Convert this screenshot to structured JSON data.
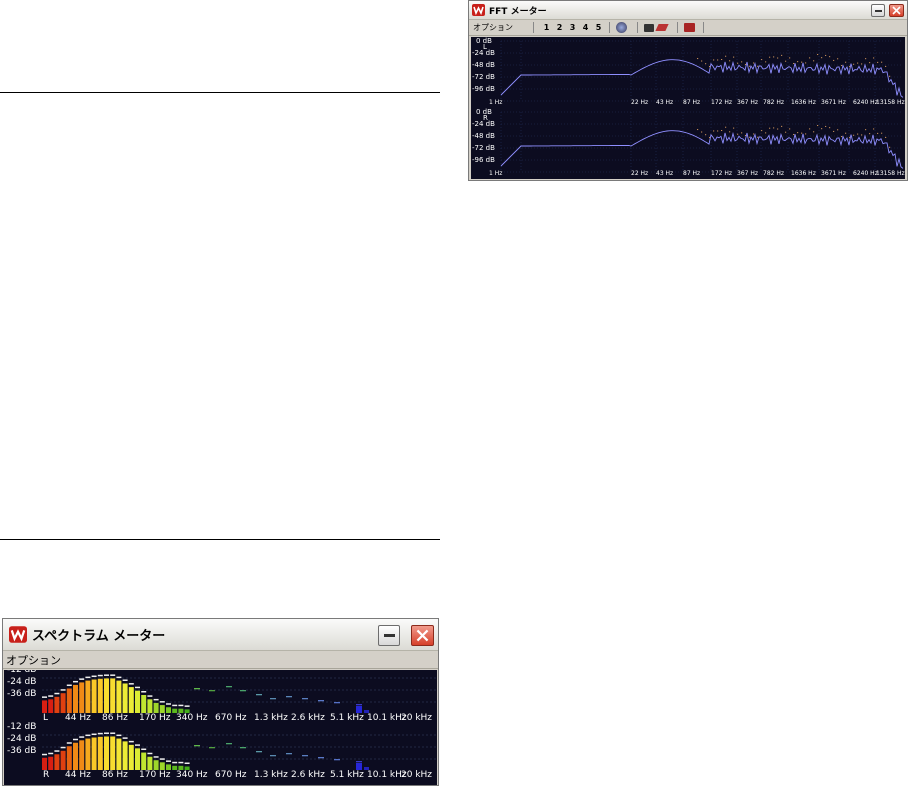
{
  "spectrum_window": {
    "title": "スペクトラム メーター",
    "menu_label": "オプション",
    "db_labels": [
      "-12 dB",
      "-24 dB",
      "-36 dB"
    ],
    "channels": [
      "L",
      "R"
    ],
    "freq_labels": [
      "44 Hz",
      "86 Hz",
      "170 Hz",
      "340 Hz",
      "670 Hz",
      "1.3 kHz",
      "2.6 kHz",
      "5.1 kHz",
      "10.1 kHz",
      "20 kHz"
    ]
  },
  "fft_window": {
    "title": "FFT メーター",
    "menu_label": "オプション",
    "preset_buttons": [
      "1",
      "2",
      "3",
      "4",
      "5"
    ],
    "db_labels": [
      "0 dB",
      "-24 dB",
      "-48 dB",
      "-72 dB",
      "-96 dB"
    ],
    "channels": [
      "L",
      "R"
    ],
    "freq_labels": [
      "1 Hz",
      "22 Hz",
      "43 Hz",
      "87 Hz",
      "172 Hz",
      "367 Hz",
      "782 Hz",
      "1636 Hz",
      "3671 Hz",
      "6240 Hz",
      "13158 Hz"
    ]
  },
  "colors": {
    "screen_bg": "#0c0c20",
    "fft_curve": "#8f8fff",
    "fft_peak": "#c8905a"
  }
}
